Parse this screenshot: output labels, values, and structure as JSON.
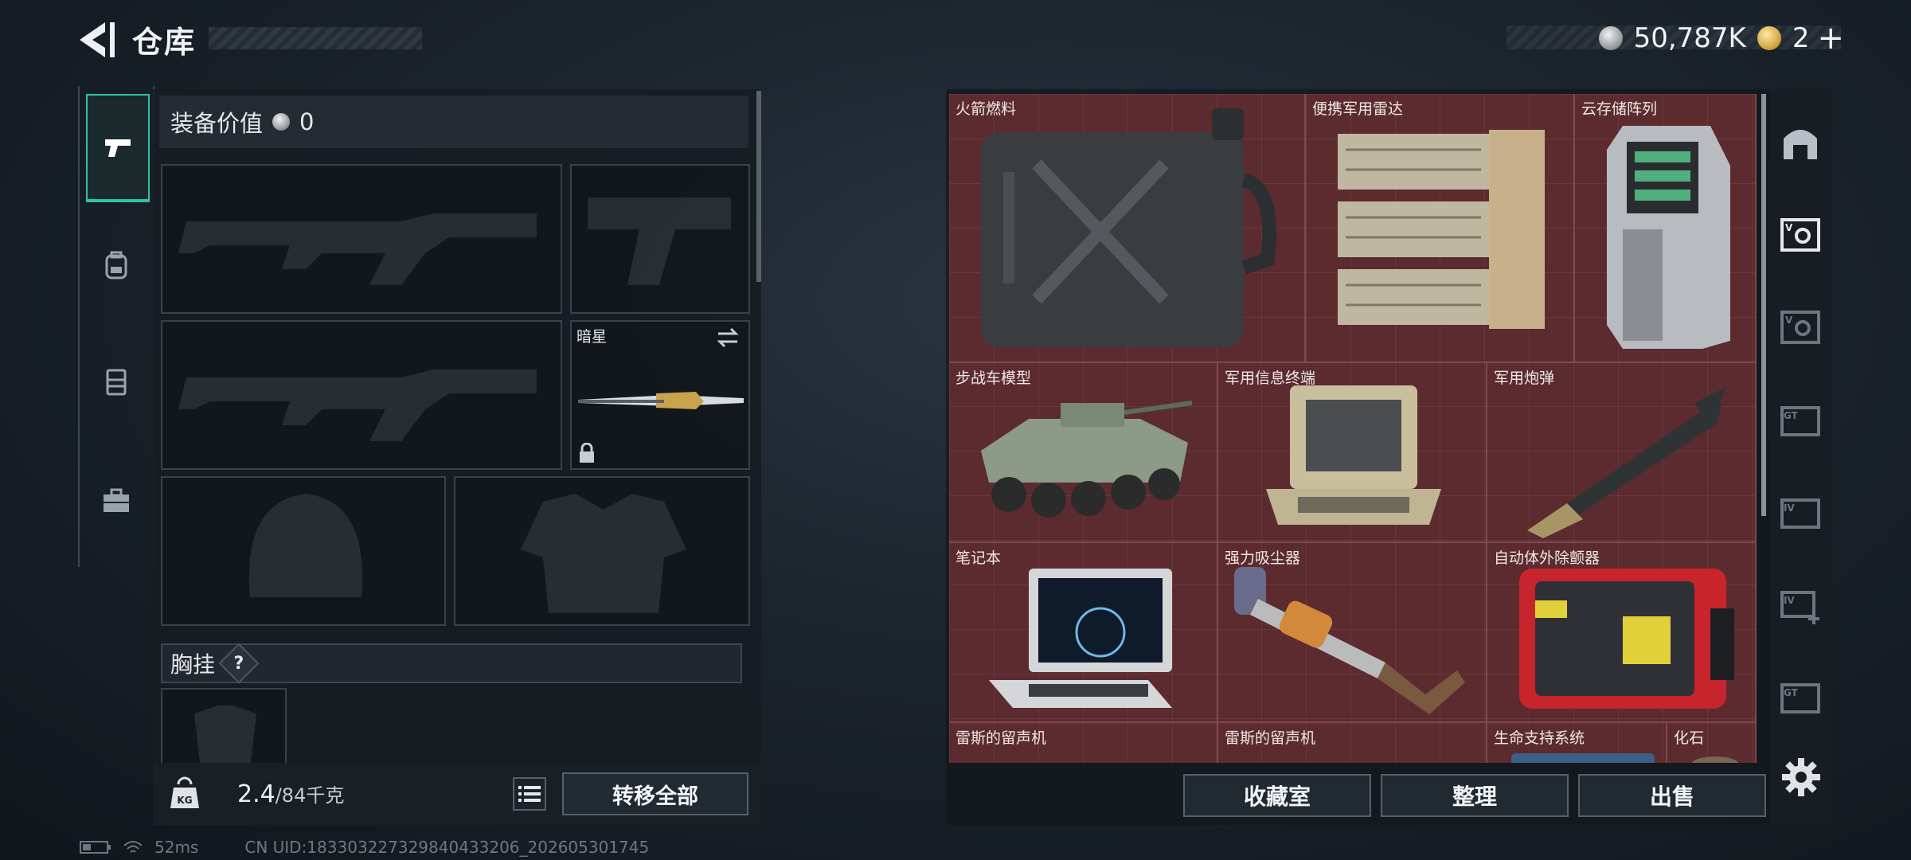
{
  "header": {
    "title": "仓库",
    "currency_amount": "50,787K",
    "premium_amount": "2",
    "premium_plus": "+"
  },
  "left_rail": {
    "tabs": [
      "weapon-tab",
      "backpack-tab",
      "armor-tab",
      "case-tab"
    ],
    "active_tab": "weapon-tab"
  },
  "equipment": {
    "value_label": "装备价值",
    "value_amount": "0",
    "melee_slot_label": "暗星",
    "chest_rig_label": "胸挂",
    "chest_rig_help": "?"
  },
  "inventory": {
    "weight_current": "2.4",
    "weight_max": "/84千克",
    "transfer_all_label": "转移全部"
  },
  "storage": {
    "items": [
      {
        "name": "火箭燃料",
        "icon": "fuel-can-icon"
      },
      {
        "name": "便携军用雷达",
        "icon": "radar-icon"
      },
      {
        "name": "云存储阵列",
        "icon": "storage-array-icon"
      },
      {
        "name": "步战车模型",
        "icon": "ifv-model-icon"
      },
      {
        "name": "军用信息终端",
        "icon": "terminal-icon"
      },
      {
        "name": "军用炮弹",
        "icon": "shell-icon"
      },
      {
        "name": "笔记本",
        "icon": "laptop-icon"
      },
      {
        "name": "强力吸尘器",
        "icon": "vacuum-icon"
      },
      {
        "name": "自动体外除颤器",
        "icon": "aed-icon"
      },
      {
        "name": "雷斯的留声机",
        "icon": "phonograph-icon"
      },
      {
        "name": "雷斯的留声机",
        "icon": "phonograph-icon"
      },
      {
        "name": "生命支持系统",
        "icon": "life-support-icon"
      },
      {
        "name": "化石",
        "icon": "fossil-icon"
      }
    ],
    "actions": {
      "collection": "收藏室",
      "sort": "整理",
      "sell": "出售"
    }
  },
  "footer": {
    "ping": "52ms",
    "uid": "CN UID:18330322732984043320​6_202605301745"
  },
  "colors": {
    "accent": "#2ec4a4",
    "storage_bg": "#5b2b30"
  }
}
